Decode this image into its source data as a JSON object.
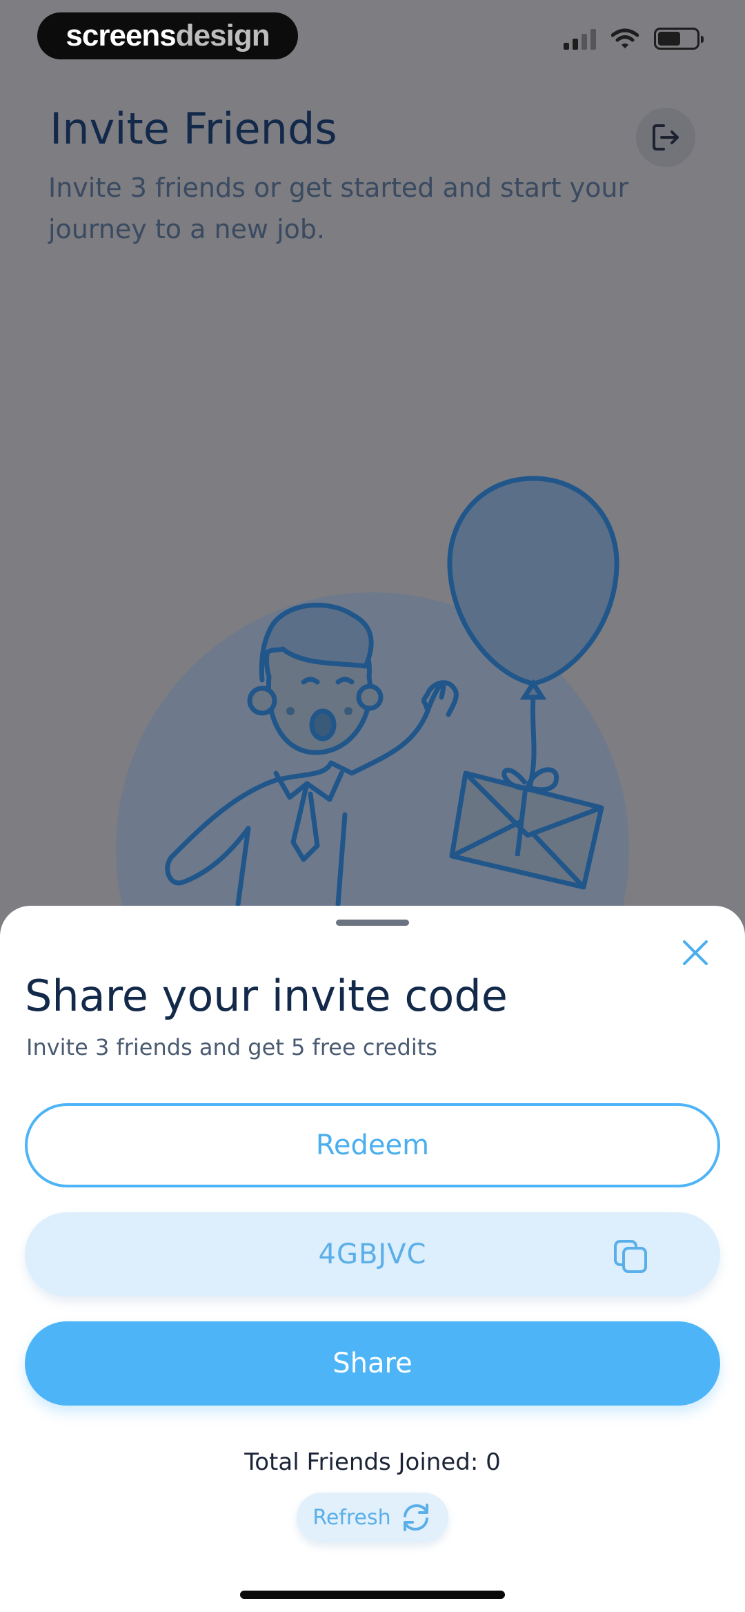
{
  "status_bar": {
    "brand_part1": "screens",
    "brand_part2": "design"
  },
  "page": {
    "title": "Invite Friends",
    "subtitle": "Invite 3 friends or get started and start your journey to a new job."
  },
  "sheet": {
    "title": "Share your invite code",
    "subtitle": "Invite 3 friends and get 5 free credits",
    "redeem_label": "Redeem",
    "invite_code": "4GBJVC",
    "share_label": "Share",
    "joined_text": "Total Friends Joined: 0",
    "refresh_label": "Refresh"
  },
  "icons": {
    "exit": "exit-icon",
    "close": "close-icon",
    "copy": "copy-icon",
    "refresh": "refresh-icon"
  },
  "colors": {
    "accent": "#4db4f7",
    "title": "#13294a",
    "code_bg": "#ddeefc"
  }
}
